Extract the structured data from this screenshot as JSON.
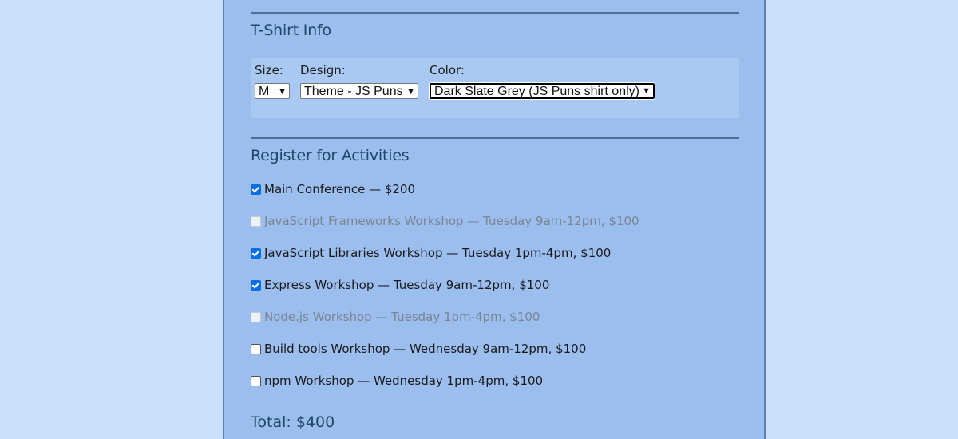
{
  "tshirt": {
    "heading": "T-Shirt Info",
    "size_label": "Size:",
    "size_value": "M",
    "design_label": "Design:",
    "design_value": "Theme - JS Puns",
    "color_label": "Color:",
    "color_value": "Dark Slate Grey (JS Puns shirt only)",
    "dropdown_icon": "chevron-down-icon"
  },
  "activities": {
    "heading": "Register for Activities",
    "items": [
      {
        "label": "Main Conference — $200",
        "checked": true,
        "disabled": false
      },
      {
        "label": "JavaScript Frameworks Workshop — Tuesday 9am-12pm, $100",
        "checked": false,
        "disabled": true
      },
      {
        "label": "JavaScript Libraries Workshop — Tuesday 1pm-4pm, $100",
        "checked": true,
        "disabled": false
      },
      {
        "label": "Express Workshop — Tuesday 9am-12pm, $100",
        "checked": true,
        "disabled": false
      },
      {
        "label": "Node.js Workshop — Tuesday 1pm-4pm, $100",
        "checked": false,
        "disabled": true
      },
      {
        "label": "Build tools Workshop — Wednesday 9am-12pm, $100",
        "checked": false,
        "disabled": false
      },
      {
        "label": "npm Workshop — Wednesday 1pm-4pm, $100",
        "checked": false,
        "disabled": false
      }
    ],
    "total": "Total: $400"
  },
  "colors": {
    "background": "#cadffa",
    "panel": "#9bbeef",
    "heading": "#1f4866",
    "checkbox_accent": "#0a6ee6",
    "disabled_text": "#7a8590"
  }
}
